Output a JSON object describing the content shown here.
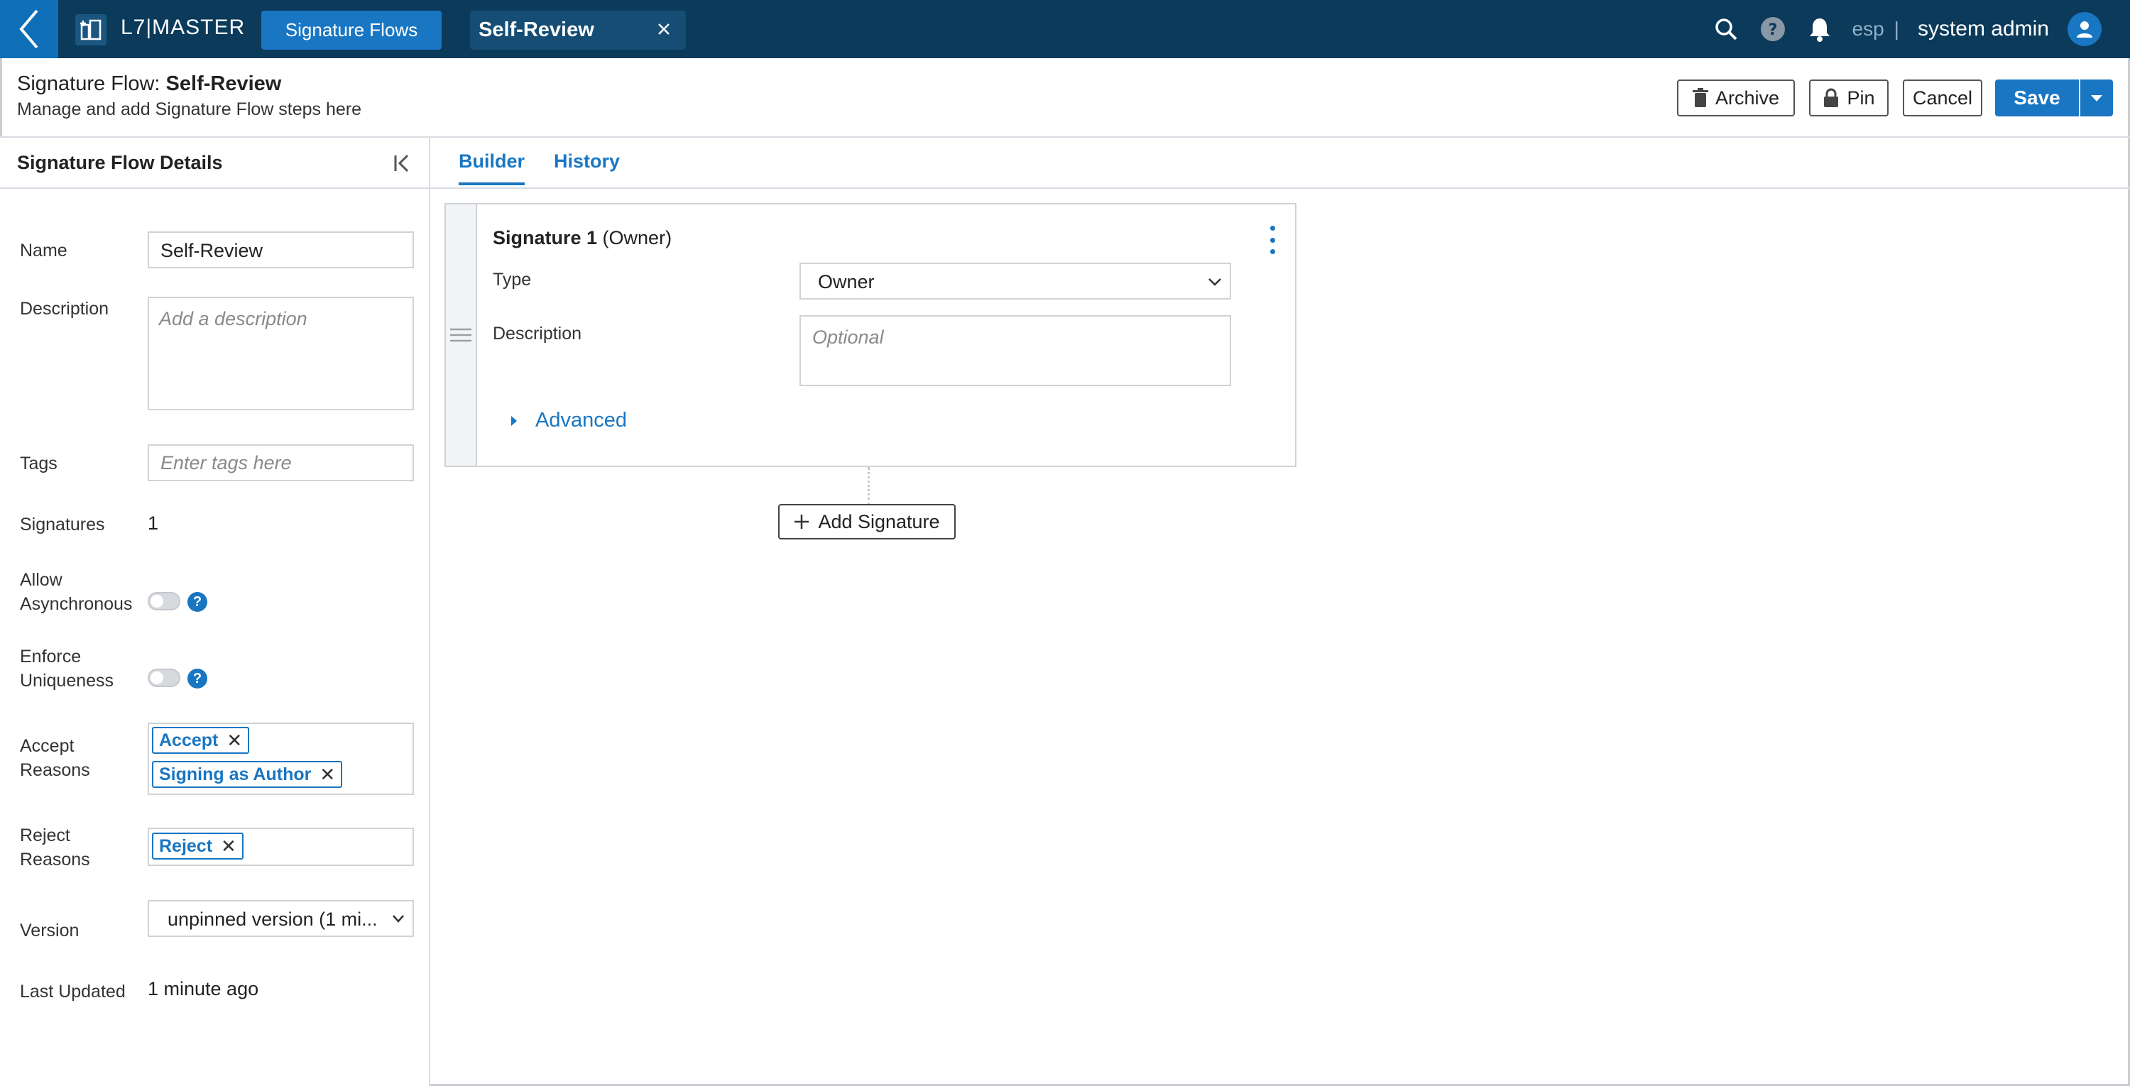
{
  "topbar": {
    "app_name": "L7|MASTER",
    "tabs": [
      {
        "label": "Signature Flows"
      },
      {
        "label": "Self-Review"
      }
    ],
    "language": "esp",
    "separator": "|",
    "user_name": "system admin"
  },
  "header": {
    "title_prefix": "Signature Flow: ",
    "title_name": "Self-Review",
    "subtitle": "Manage and add Signature Flow steps here",
    "archive_label": "Archive",
    "pin_label": "Pin",
    "cancel_label": "Cancel",
    "save_label": "Save"
  },
  "details": {
    "title": "Signature Flow Details",
    "name_label": "Name",
    "name_value": "Self-Review",
    "description_label": "Description",
    "description_placeholder": "Add a description",
    "tags_label": "Tags",
    "tags_placeholder": "Enter tags here",
    "signatures_label": "Signatures",
    "signatures_value": "1",
    "allow_async_label_1": "Allow",
    "allow_async_label_2": "Asynchronous",
    "enforce_label_1": "Enforce",
    "enforce_label_2": "Uniqueness",
    "accept_label_1": "Accept",
    "accept_label_2": "Reasons",
    "accept_reasons": [
      "Accept",
      "Signing as Author"
    ],
    "reject_label_1": "Reject",
    "reject_label_2": "Reasons",
    "reject_reasons": [
      "Reject"
    ],
    "version_label": "Version",
    "version_value": "unpinned version (1 mi...",
    "last_updated_label": "Last Updated",
    "last_updated_value": "1 minute ago",
    "help_glyph": "?"
  },
  "builder": {
    "tabs": [
      {
        "label": "Builder"
      },
      {
        "label": "History"
      }
    ],
    "signature": {
      "title_bold": "Signature 1",
      "title_rest": " (Owner)",
      "type_label": "Type",
      "type_value": "Owner",
      "description_label": "Description",
      "description_placeholder": "Optional",
      "advanced_label": "Advanced"
    },
    "add_signature_label": "Add Signature"
  },
  "colors": {
    "topbar": "#0b3a5a",
    "accent": "#1976c2"
  }
}
